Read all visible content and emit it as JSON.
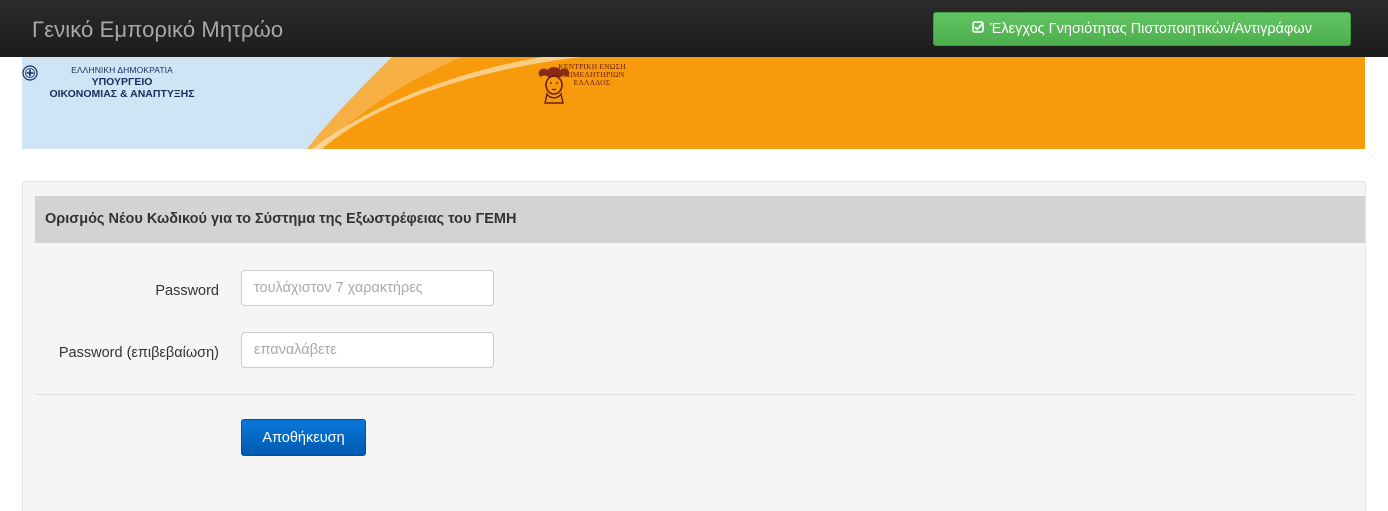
{
  "navbar": {
    "brand": "Γενικό Εμπορικό Μητρώο",
    "verify_button_label": "Έλεγχος Γνησιότητας Πιστοποιητικών/Αντιγράφων",
    "verify_button_icon": "check-square-icon"
  },
  "banner": {
    "ministry_line1": "ΕΛΛΗΝΙΚΗ ΔΗΜΟΚΡΑΤΙΑ",
    "ministry_line2": "ΥΠΟΥΡΓΕΙΟ",
    "ministry_line3": "ΟΙΚΟΝΟΜΙΑΣ & ΑΝΑΠΤΥΞΗΣ",
    "chamber_line1": "ΚΕΝΤΡΙΚΗ ΕΝΩΣΗ",
    "chamber_line2": "ΕΠΙΜΕΛΗΤΗΡΙΩΝ",
    "chamber_line3": "ΕΛΛΑΔΟΣ",
    "orange_color": "#f79a0c",
    "light_blue_color": "#cfe4f4"
  },
  "form": {
    "title": "Ορισμός Νέου Κωδικού για το Σύστημα της Εξωστρέφειας του ΓΕΜΗ",
    "password_label": "Password",
    "password_placeholder": "τουλάχιστον 7 χαρακτήρες",
    "confirm_label": "Password (επιβεβαίωση)",
    "confirm_placeholder": "επαναλάβετε",
    "save_label": "Αποθήκευση"
  },
  "colors": {
    "navbar_bg": "#222222",
    "success_green": "#5cb85c",
    "primary_blue": "#0a6fc9",
    "panel_heading_bg": "#d3d3d3"
  }
}
